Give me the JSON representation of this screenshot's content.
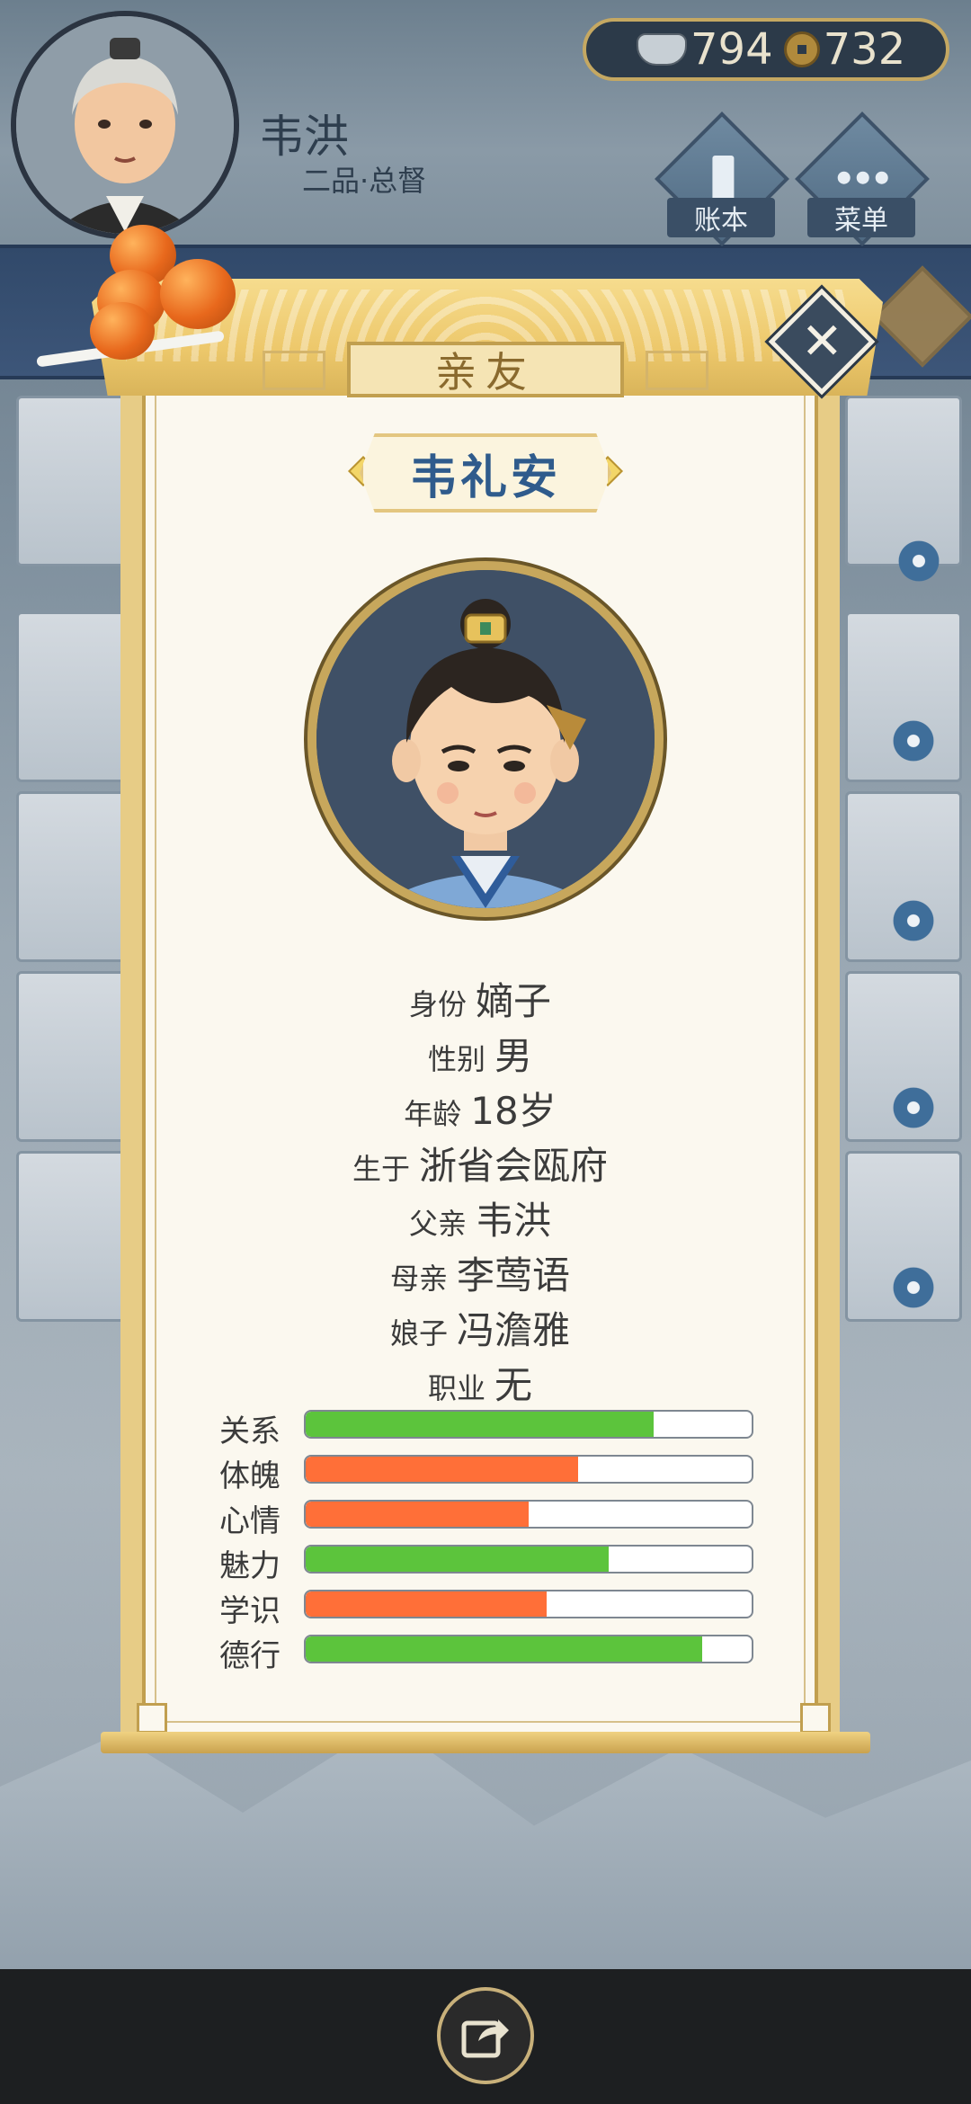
{
  "header": {
    "player_name": "韦洪",
    "player_title": "二品·总督",
    "silver": "794",
    "coins": "732",
    "buttons": [
      {
        "label": "账本"
      },
      {
        "label": "菜单"
      }
    ]
  },
  "dialog": {
    "title": "亲友",
    "close_symbol": "✕",
    "person_name": "韦礼安",
    "info": [
      {
        "label": "身份",
        "value": "嫡子"
      },
      {
        "label": "性别",
        "value": "男"
      },
      {
        "label": "年龄",
        "value": "18岁"
      },
      {
        "label": "生于",
        "value": "浙省会瓯府"
      },
      {
        "label": "父亲",
        "value": "韦洪"
      },
      {
        "label": "母亲",
        "value": "李莺语"
      },
      {
        "label": "娘子",
        "value": "冯澹雅"
      },
      {
        "label": "职业",
        "value": "无"
      }
    ],
    "stats": [
      {
        "label": "关系",
        "level": 0.78,
        "color": "green"
      },
      {
        "label": "体魄",
        "level": 0.61,
        "color": "orange"
      },
      {
        "label": "心情",
        "level": 0.5,
        "color": "orange"
      },
      {
        "label": "魅力",
        "level": 0.68,
        "color": "green"
      },
      {
        "label": "学识",
        "level": 0.54,
        "color": "orange"
      },
      {
        "label": "德行",
        "level": 0.89,
        "color": "green"
      }
    ]
  },
  "colors": {
    "green_bar": "#5cc43c",
    "orange_bar": "#ff6f38",
    "name_blue": "#2f5b8c",
    "scroll_gold": "#e7cc86"
  },
  "icons": {
    "silver": "silver-ingot-icon",
    "coin": "copper-coin-icon",
    "ledger": "ledger-icon",
    "menu": "more-dots-icon",
    "close": "close-icon",
    "share": "share-icon"
  }
}
